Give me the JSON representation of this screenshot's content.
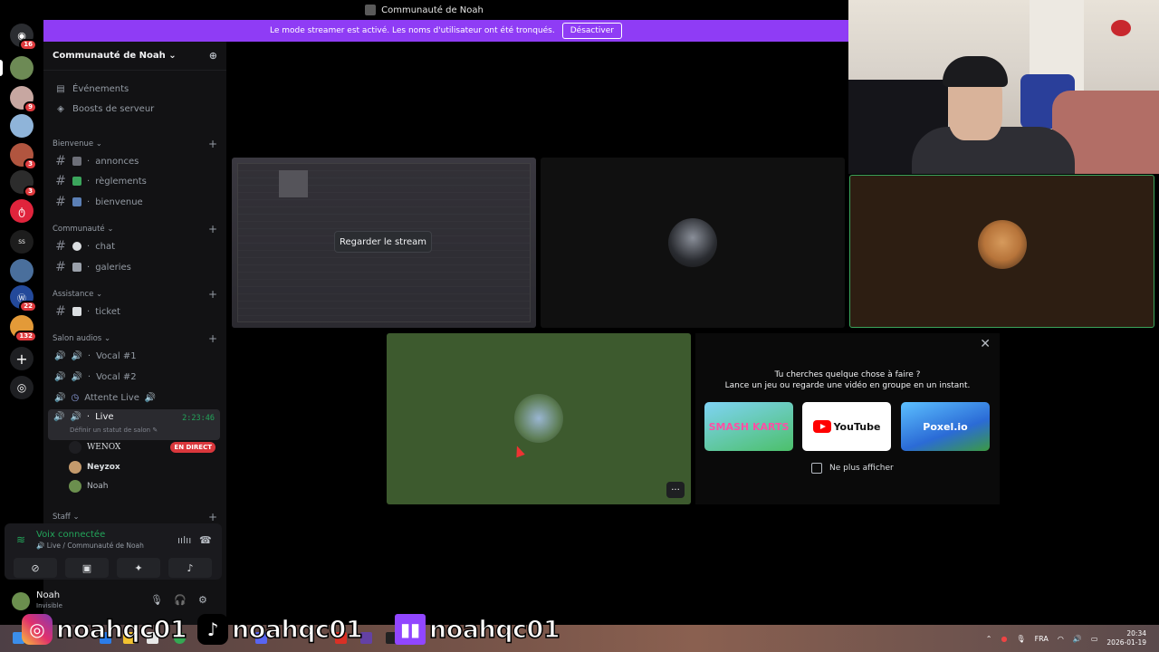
{
  "window": {
    "title": "Communauté de Noah"
  },
  "banner": {
    "text": "Le mode streamer est activé. Les noms d'utilisateur ont été tronqués.",
    "button": "Désactiver"
  },
  "servers": [
    {
      "icon": "discord-home-icon",
      "badge": "16"
    },
    {
      "icon": "server-icon",
      "badge": ""
    },
    {
      "icon": "server-icon",
      "badge": "9"
    },
    {
      "icon": "server-icon",
      "badge": ""
    },
    {
      "icon": "server-icon",
      "badge": "3"
    },
    {
      "icon": "server-icon",
      "badge": "3"
    },
    {
      "icon": "server-icon",
      "badge": ""
    },
    {
      "icon": "server-icon",
      "badge": ""
    },
    {
      "icon": "server-icon",
      "badge": ""
    },
    {
      "icon": "server-icon",
      "badge": "22"
    },
    {
      "icon": "server-icon",
      "badge": "132"
    }
  ],
  "sidebar": {
    "server_name": "Communauté de Noah",
    "top_items": [
      {
        "label": "Événements",
        "icon": "calendar-icon"
      },
      {
        "label": "Boosts de serveur",
        "icon": "boost-icon"
      }
    ],
    "categories": {
      "bienvenue": "Bienvenue",
      "communaute": "Communauté",
      "assistance": "Assistance",
      "salon_audios": "Salon audios",
      "staff": "Staff"
    },
    "channels": {
      "annonces": "annonces",
      "reglements": "règlements",
      "bienvenue": "bienvenue",
      "chat": "chat",
      "galeries": "galeries",
      "ticket": "ticket",
      "vocal1": "Vocal #1",
      "vocal2": "Vocal #2",
      "attente": "Attente Live",
      "live": "Live"
    },
    "live_timer": "2:23:46",
    "live_status": "Définir un statut de salon",
    "voice_users": [
      {
        "name": "WENOX",
        "badge": "EN DIRECT"
      },
      {
        "name": "Neyzox",
        "badge": ""
      },
      {
        "name": "Noah",
        "badge": ""
      }
    ]
  },
  "voice_panel": {
    "title": "Voix connectée",
    "subtitle": "Live / Communauté de Noah"
  },
  "user_panel": {
    "name": "Noah",
    "status": "Invisible"
  },
  "stage": {
    "watch_button": "Regarder le stream",
    "more": "···"
  },
  "activity": {
    "question": "Tu cherches quelque chose à faire ?",
    "subtitle": "Lance un jeu ou regarde une vidéo en groupe en un instant.",
    "apps": [
      "SMASH KARTS",
      "YouTube",
      "Poxel.io"
    ],
    "checkbox_label": "Ne plus afficher"
  },
  "overlay": {
    "handles": [
      "noahqc01",
      "noahqc01",
      "noahqc01"
    ]
  },
  "taskbar": {
    "lang": "FRA",
    "time": "20:34",
    "date": "2026-01-19"
  },
  "colors": {
    "banner": "#8f3cf5",
    "voice_green": "#23a55a",
    "live_red": "#da373c"
  }
}
